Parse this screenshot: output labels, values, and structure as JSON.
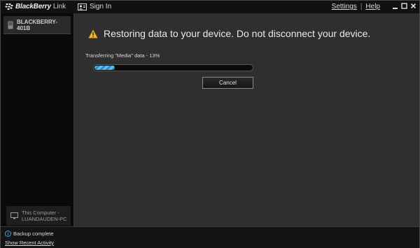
{
  "titlebar": {
    "brand_name": "BlackBerry",
    "brand_suffix": "Link",
    "sign_in": "Sign In",
    "settings": "Settings",
    "separator": "|",
    "help": "Help",
    "window_controls": [
      "minimize-icon",
      "maximize-icon",
      "close-icon"
    ]
  },
  "sidebar": {
    "device_name": "BLACKBERRY-401B",
    "computer_line1": "This Computer -",
    "computer_line2": "LUANDAUDEN-PC"
  },
  "main": {
    "headline": "Restoring data to your device. Do not disconnect your device.",
    "progress_label": "Transferring \"Media\"  data - 13%",
    "progress_fraction": 0.13,
    "cancel_label": "Cancel"
  },
  "statusbar": {
    "status_text": "Backup complete",
    "recent_link": "Show Recent Activity"
  },
  "colors": {
    "accent_progress": "#5fc2ee",
    "warning": "#f2b51c",
    "info": "#4a9fd8"
  }
}
